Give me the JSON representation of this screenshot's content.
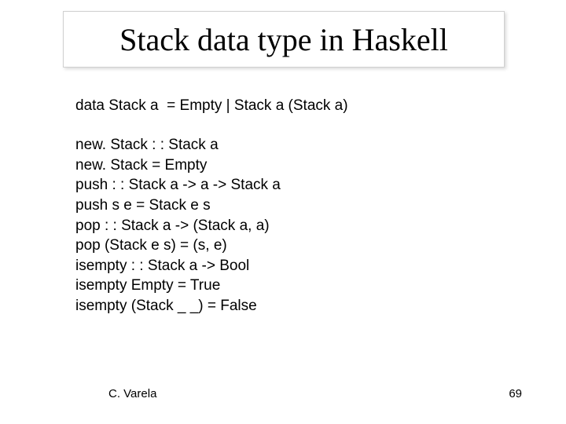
{
  "title": "Stack data type in Haskell",
  "dataDecl": "data Stack a  = Empty | Stack a (Stack a)",
  "code": [
    "new. Stack : : Stack a",
    "new. Stack = Empty",
    "push : : Stack a -> a -> Stack a",
    "push s e = Stack e s",
    "pop : : Stack a -> (Stack a, a)",
    "pop (Stack e s) = (s, e)",
    "isempty : : Stack a -> Bool",
    "isempty Empty = True",
    "isempty (Stack _ _) = False"
  ],
  "footer": {
    "author": "C. Varela",
    "page": "69"
  }
}
